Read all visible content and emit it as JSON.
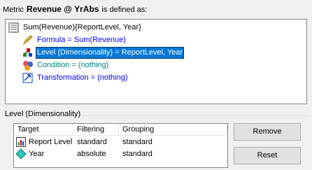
{
  "header": {
    "prefix": "Metric",
    "metric_name": "Revenue @ YrAbs",
    "suffix": "is defined as:"
  },
  "tree": {
    "root": "Sum(Revenue){ReportLevel, Year}",
    "formula": "Formula = Sum(Revenue)",
    "level": "Level (Dimensionality) = ReportLevel, Year",
    "condition": "Condition = (nothing)",
    "transformation": "Transformation = (nothing)"
  },
  "level_group": {
    "title": "Level (Dimensionality)",
    "columns": [
      "Target",
      "Filtering",
      "Grouping"
    ],
    "rows": [
      {
        "target": "Report Level",
        "filtering": "standard",
        "grouping": "standard",
        "icon": "report-level-icon"
      },
      {
        "target": "Year",
        "filtering": "absolute",
        "grouping": "standard",
        "icon": "attribute-diamond-icon"
      }
    ]
  },
  "buttons": {
    "remove": "Remove",
    "reset": "Reset"
  },
  "colors": {
    "selection": "#0078d7",
    "link_blue": "#0000ff",
    "condition_teal": "#008080"
  }
}
